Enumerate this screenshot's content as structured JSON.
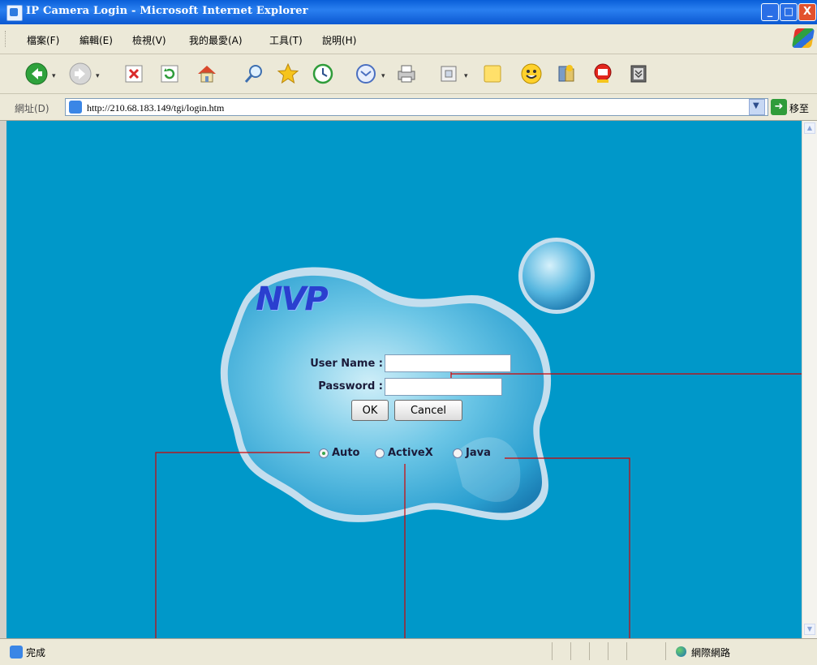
{
  "window": {
    "title": "IP Camera Login - Microsoft Internet Explorer",
    "minimize": "_",
    "maximize": "□",
    "close": "X"
  },
  "menu": [
    "檔案(F)",
    "編輯(E)",
    "檢視(V)",
    "我的最愛(A)",
    "工具(T)",
    "說明(H)"
  ],
  "toolbar": {
    "icons": [
      "back-icon",
      "forward-icon",
      "stop-icon",
      "refresh-icon",
      "home-icon",
      "search-icon",
      "favorites-icon",
      "history-icon",
      "mail-icon",
      "print-icon",
      "edit-icon",
      "notes-icon",
      "messenger-icon",
      "research-icon",
      "plugin-icon",
      "menu-icon"
    ]
  },
  "address": {
    "label": "網址(D)",
    "url": "http://210.68.183.149/tgi/login.htm",
    "go_label": "移至"
  },
  "login": {
    "logo": "NVP",
    "username_label": "User Name :",
    "password_label": "Password :",
    "username_value": "",
    "password_value": "",
    "ok_label": "OK",
    "cancel_label": "Cancel",
    "modes": [
      {
        "label": "Auto",
        "selected": true
      },
      {
        "label": "ActiveX",
        "selected": false
      },
      {
        "label": "Java",
        "selected": false
      }
    ]
  },
  "status": {
    "text": "完成",
    "zone": "網際網路"
  },
  "colors": {
    "background": "#0098c9",
    "annotation": "#d40000"
  }
}
